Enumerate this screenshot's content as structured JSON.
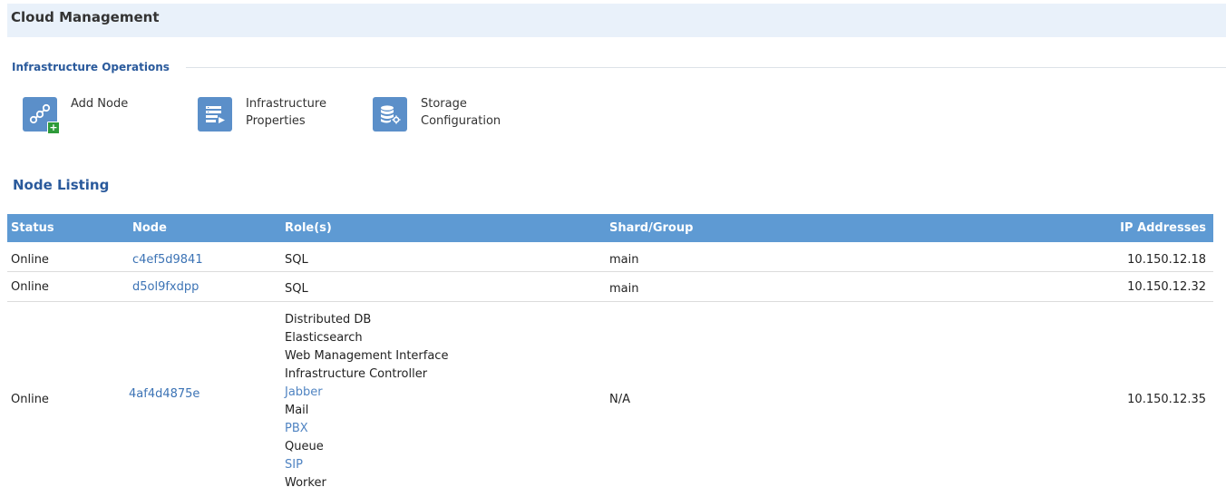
{
  "header": {
    "title": "Cloud Management"
  },
  "infrastructure_operations": {
    "heading": "Infrastructure Operations",
    "actions": [
      {
        "label": "Add Node",
        "icon": "add-node-icon"
      },
      {
        "label": "Infrastructure\nProperties",
        "icon": "infrastructure-properties-icon"
      },
      {
        "label": "Storage\nConfiguration",
        "icon": "storage-configuration-icon"
      }
    ]
  },
  "node_listing": {
    "heading": "Node Listing",
    "columns": [
      "Status",
      "Node",
      "Role(s)",
      "Shard/Group",
      "IP Addresses"
    ],
    "rows": [
      {
        "status": "Online",
        "node": "c4ef5d9841",
        "roles": [
          "SQL"
        ],
        "shard": "main",
        "ip": "10.150.12.18"
      },
      {
        "status": "Online",
        "node": "d5ol9fxdpp",
        "roles": [
          "SQL"
        ],
        "shard": "main",
        "ip": "10.150.12.32"
      },
      {
        "status": "Online",
        "node": "4af4d4875e",
        "roles": [
          "Distributed DB",
          "Elasticsearch",
          "Web Management Interface",
          "Infrastructure Controller",
          "Jabber",
          "Mail",
          "PBX",
          "Queue",
          "SIP",
          "Worker"
        ],
        "shard": "N/A",
        "ip": "10.150.12.35"
      }
    ]
  },
  "colors": {
    "header_bg": "#e9f1fa",
    "table_header": "#5e9ad3",
    "accent": "#2a5a9c",
    "link": "#3c73b5",
    "tile": "#5b8fc9",
    "badge": "#2e9b3a"
  }
}
